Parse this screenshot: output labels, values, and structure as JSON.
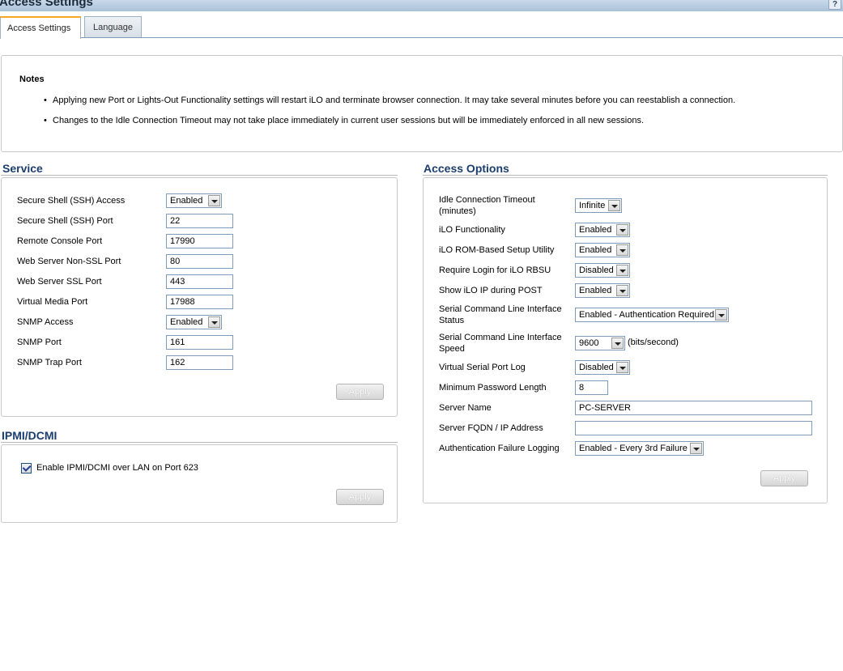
{
  "window": {
    "title": "Access Settings"
  },
  "tabs": [
    {
      "label": "Access Settings"
    },
    {
      "label": "Language"
    }
  ],
  "notes": {
    "heading": "Notes",
    "items": [
      "Applying new Port or Lights-Out Functionality settings will restart iLO and terminate browser connection. It may take several minutes before you can reestablish a connection.",
      "Changes to the Idle Connection Timeout may not take place immediately in current user sessions but will be immediately enforced in all new sessions."
    ]
  },
  "service": {
    "title": "Service",
    "rows": [
      {
        "label": "Secure Shell (SSH) Access",
        "value": "Enabled"
      },
      {
        "label": "Secure Shell (SSH) Port",
        "value": "22"
      },
      {
        "label": "Remote Console Port",
        "value": "17990"
      },
      {
        "label": "Web Server Non-SSL Port",
        "value": "80"
      },
      {
        "label": "Web Server SSL Port",
        "value": "443"
      },
      {
        "label": "Virtual Media Port",
        "value": "17988"
      },
      {
        "label": "SNMP Access",
        "value": "Enabled"
      },
      {
        "label": "SNMP Port",
        "value": "161"
      },
      {
        "label": "SNMP Trap Port",
        "value": "162"
      }
    ],
    "apply_label": "Apply"
  },
  "ipmi": {
    "title": "IPMI/DCMI",
    "checkbox_label": "Enable IPMI/DCMI over LAN on Port 623",
    "checked": true,
    "apply_label": "Apply"
  },
  "access_options": {
    "title": "Access Options",
    "rows": [
      {
        "label": "Idle Connection Timeout\n(minutes)",
        "value": "Infinite"
      },
      {
        "label": "iLO Functionality",
        "value": "Enabled"
      },
      {
        "label": "iLO ROM-Based Setup Utility",
        "value": "Enabled"
      },
      {
        "label": "Require Login for iLO RBSU",
        "value": "Disabled"
      },
      {
        "label": "Show iLO IP during POST",
        "value": "Enabled"
      },
      {
        "label": "Serial Command Line Interface\nStatus",
        "value": "Enabled - Authentication Required"
      },
      {
        "label": "Serial Command Line Interface\nSpeed",
        "value": "9600",
        "unit": "(bits/second)"
      },
      {
        "label": "Virtual Serial Port Log",
        "value": "Disabled"
      },
      {
        "label": "Minimum Password Length",
        "value": "8"
      },
      {
        "label": "Server Name",
        "value": "PC-SERVER"
      },
      {
        "label": "Server FQDN / IP Address",
        "value": ""
      },
      {
        "label": "Authentication Failure Logging",
        "value": "Enabled - Every 3rd Failure"
      }
    ],
    "apply_label": "Apply"
  }
}
